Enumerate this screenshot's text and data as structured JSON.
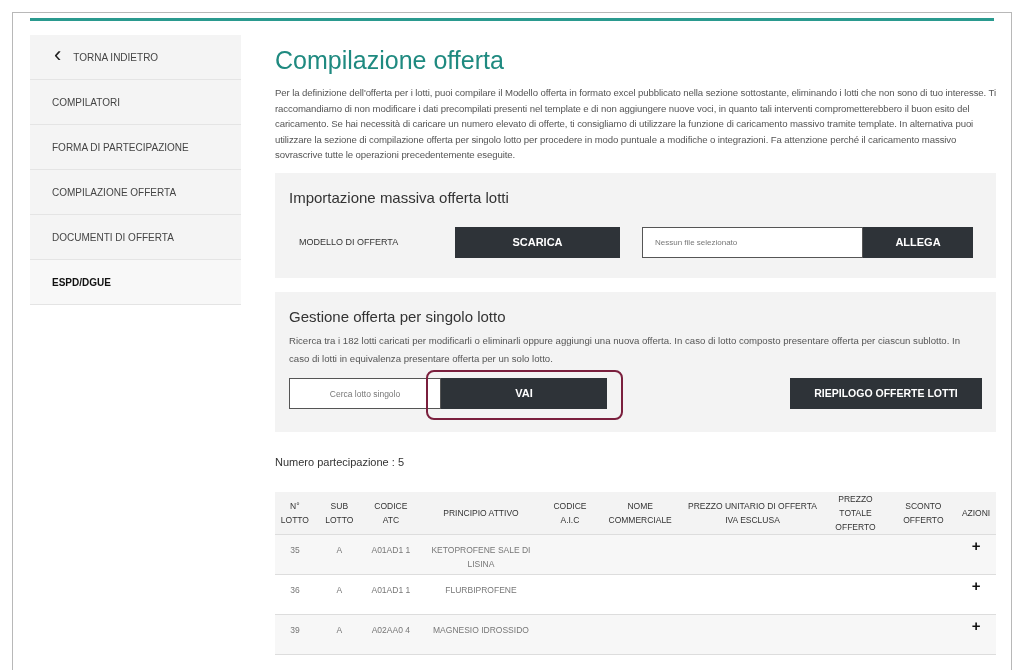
{
  "sidebar": {
    "back": {
      "icon": "‹",
      "label": "TORNA INDIETRO"
    },
    "items": [
      {
        "label": "COMPILATORI",
        "selected": false
      },
      {
        "label": "FORMA DI PARTECIPAZIONE",
        "selected": false
      },
      {
        "label": "COMPILAZIONE OFFERTA",
        "selected": false
      },
      {
        "label": "DOCUMENTI DI OFFERTA",
        "selected": false
      },
      {
        "label": "ESPD/DGUE",
        "selected": true
      }
    ]
  },
  "title": "Compilazione offerta",
  "intro": "Per la definizione dell'offerta per i lotti, puoi compilare il Modello offerta in formato excel pubblicato nella sezione sottostante, eliminando i lotti che non sono di tuo interesse. Ti raccomandiamo di non modificare i dati precompilati presenti nel template e di non aggiungere nuove voci, in quanto tali interventi comprometterebbero il buon esito del caricamento. Se hai necessità di caricare un numero elevato di offerte, ti consigliamo di utilizzare la funzione di caricamento massivo tramite template. In alternativa puoi utilizzare la sezione di compilazione offerta per singolo lotto per procedere in modo puntuale a modifiche o integrazioni. Fa attenzione perché il caricamento massivo sovrascrive tutte le operazioni precedentemente eseguite.",
  "import_section": {
    "title": "Importazione massiva offerta lotti",
    "label": "MODELLO DI OFFERTA",
    "download_button": "SCARICA",
    "file_placeholder": "Nessun file selezionato",
    "attach_button": "ALLEGA"
  },
  "single_section": {
    "title": "Gestione offerta per singolo lotto",
    "description": "Ricerca tra i 182 lotti caricati per modificarli o eliminarli oppure aggiungi una nuova offerta. In caso di lotto composto presentare offerta per ciascun sublotto. In caso di lotti in equivalenza presentare offerta per un solo lotto.",
    "search_placeholder": "Cerca lotto singolo",
    "go_button": "VAI",
    "summary_button": "RIEPILOGO OFFERTE LOTTI"
  },
  "participation": "Numero partecipazione : 5",
  "table": {
    "columns": [
      "N° LOTTO",
      "SUB LOTTO",
      "CODICE ATC",
      "PRINCIPIO ATTIVO",
      "CODICE A.I.C",
      "NOME COMMERCIALE",
      "PREZZO UNITARIO DI OFFERTA IVA ESCLUSA",
      "PREZZO TOTALE OFFERTO",
      "SCONTO OFFERTO",
      "AZIONI"
    ],
    "rows": [
      {
        "cells": [
          "35",
          "A",
          "A01AD1 1",
          "KETOPROFENE SALE DI LISINA",
          "",
          "",
          "",
          "",
          "",
          "+"
        ]
      },
      {
        "cells": [
          "36",
          "A",
          "A01AD1 1",
          "FLURBIPROFENE",
          "",
          "",
          "",
          "",
          "",
          "+"
        ]
      },
      {
        "cells": [
          "39",
          "A",
          "A02AA0 4",
          "MAGNESIO IDROSSIDO",
          "",
          "",
          "",
          "",
          "",
          "+"
        ]
      }
    ]
  }
}
